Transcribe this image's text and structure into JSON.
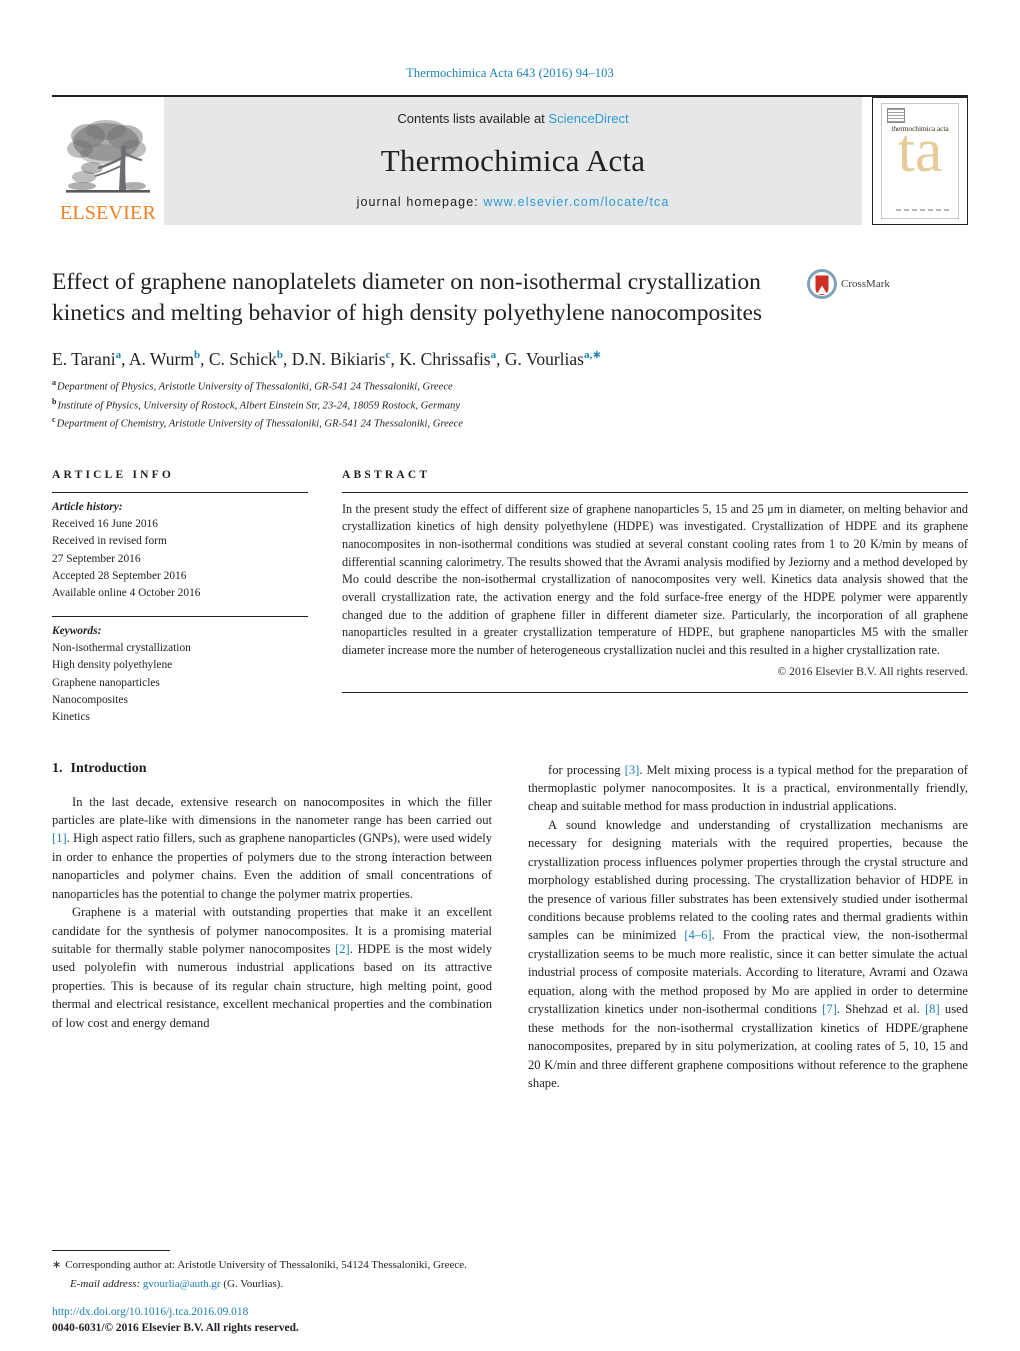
{
  "running_head": "Thermochimica Acta 643 (2016) 94–103",
  "masthead": {
    "publisher": "ELSEVIER",
    "contents_prefix": "Contents lists available at",
    "contents_link": "ScienceDirect",
    "journal_title": "Thermochimica Acta",
    "homepage_prefix": "journal homepage:",
    "homepage_link": "www.elsevier.com/locate/tca",
    "cover_journal_name": "thermochimica acta",
    "cover_monogram": "ta",
    "link_color": "#2e9bd6"
  },
  "article": {
    "title": "Effect of graphene nanoplatelets diameter on non-isothermal crystallization kinetics and melting behavior of high density polyethylene nanocomposites",
    "crossmark_label": "CrossMark",
    "authors_html": "E. Tarani<sup class=\"aff-mark\">a</sup>, A. Wurm<sup class=\"aff-mark\">b</sup>, C. Schick<sup class=\"aff-mark\">b</sup>, D.N. Bikiaris<sup class=\"aff-mark\">c</sup>, K. Chrissafis<sup class=\"aff-mark\">a</sup>, G. Vourlias<sup class=\"aff-mark\">a</sup><sup class=\"aff-mark\">,∗</sup>",
    "affiliations": [
      {
        "letter": "a",
        "text": "Department of Physics, Aristotle University of Thessaloniki, GR-541 24 Thessaloniki, Greece"
      },
      {
        "letter": "b",
        "text": "Institute of Physics, University of Rostock, Albert Einstein Str, 23-24, 18059 Rostock, Germany"
      },
      {
        "letter": "c",
        "text": "Department of Chemistry, Aristotle University of Thessaloniki, GR-541 24 Thessaloniki, Greece"
      }
    ]
  },
  "article_info": {
    "heading": "ARTICLE INFO",
    "history_label": "Article history:",
    "history_lines": [
      "Received 16 June 2016",
      "Received in revised form",
      "27 September 2016",
      "Accepted 28 September 2016",
      "Available online 4 October 2016"
    ],
    "keywords_label": "Keywords:",
    "keywords": [
      "Non-isothermal crystallization",
      "High density polyethylene",
      "Graphene nanoparticles",
      "Nanocomposites",
      "Kinetics"
    ]
  },
  "abstract": {
    "heading": "ABSTRACT",
    "text": "In the present study the effect of different size of graphene nanoparticles 5, 15 and 25 μm in diameter, on melting behavior and crystallization kinetics of high density polyethylene (HDPE) was investigated. Crystallization of HDPE and its graphene nanocomposites in non-isothermal conditions was studied at several constant cooling rates from 1 to 20 K/min by means of differential scanning calorimetry. The results showed that the Avrami analysis modified by Jeziorny and a method developed by Mo could describe the non-isothermal crystallization of nanocomposites very well. Kinetics data analysis showed that the overall crystallization rate, the activation energy and the fold surface-free energy of the HDPE polymer were apparently changed due to the addition of graphene filler in different diameter size. Particularly, the incorporation of all graphene nanoparticles resulted in a greater crystallization temperature of HDPE, but graphene nanoparticles M5 with the smaller diameter increase more the number of heterogeneous crystallization nuclei and this resulted in a higher crystallization rate.",
    "copyright": "© 2016 Elsevier B.V. All rights reserved."
  },
  "introduction": {
    "number": "1.",
    "heading": "Introduction",
    "left_paragraphs_html": [
      "In the last decade, extensive research on nanocomposites in which the filler particles are plate-like with dimensions in the nanometer range has been carried out <span class=\"cite\">[1]</span>. High aspect ratio fillers, such as graphene nanoparticles (GNPs), were used widely in order to enhance the properties of polymers due to the strong interaction between nanoparticles and polymer chains. Even the addition of small concentrations of nanoparticles has the potential to change the polymer matrix properties.",
      "Graphene is a material with outstanding properties that make it an excellent candidate for the synthesis of polymer nanocomposites. It is a promising material suitable for thermally stable polymer nanocomposites <span class=\"cite\">[2]</span>. HDPE is the most widely used polyolefin with numerous industrial applications based on its attractive properties. This is because of its regular chain structure, high melting point, good thermal and electrical resistance, excellent mechanical properties and the combination of low cost and energy demand"
    ],
    "right_paragraphs_html": [
      "for processing <span class=\"cite\">[3]</span>. Melt mixing process is a typical method for the preparation of thermoplastic polymer nanocomposites. It is a practical, environmentally friendly, cheap and suitable method for mass production in industrial applications.",
      "A sound knowledge and understanding of crystallization mechanisms are necessary for designing materials with the required properties, because the crystallization process influences polymer properties through the crystal structure and morphology established during processing. The crystallization behavior of HDPE in the presence of various filler substrates has been extensively studied under isothermal conditions because problems related to the cooling rates and thermal gradients within samples can be minimized <span class=\"cite\">[4–6]</span>. From the practical view, the non-isothermal crystallization seems to be much more realistic, since it can better simulate the actual industrial process of composite materials. According to literature, Avrami and Ozawa equation, along with the method proposed by Mo are applied in order to determine crystallization kinetics under non-isothermal conditions <span class=\"cite\">[7]</span>. Shehzad et al. <span class=\"cite\">[8]</span> used these methods for the non-isothermal crystallization kinetics of HDPE/graphene nanocomposites, prepared by in situ polymerization, at cooling rates of 5, 10, 15 and 20 K/min and three different graphene compositions without reference to the graphene shape."
    ]
  },
  "footer": {
    "corresponding_star": "∗",
    "corresponding_text": "Corresponding author at: Aristotle University of Thessaloniki, 54124 Thessaloniki, Greece.",
    "email_label": "E-mail address:",
    "email": "gvourlia@auth.gr",
    "email_owner": "(G. Vourlias).",
    "doi": "http://dx.doi.org/10.1016/j.tca.2016.09.018",
    "issn_line": "0040-6031/© 2016 Elsevier B.V. All rights reserved."
  }
}
